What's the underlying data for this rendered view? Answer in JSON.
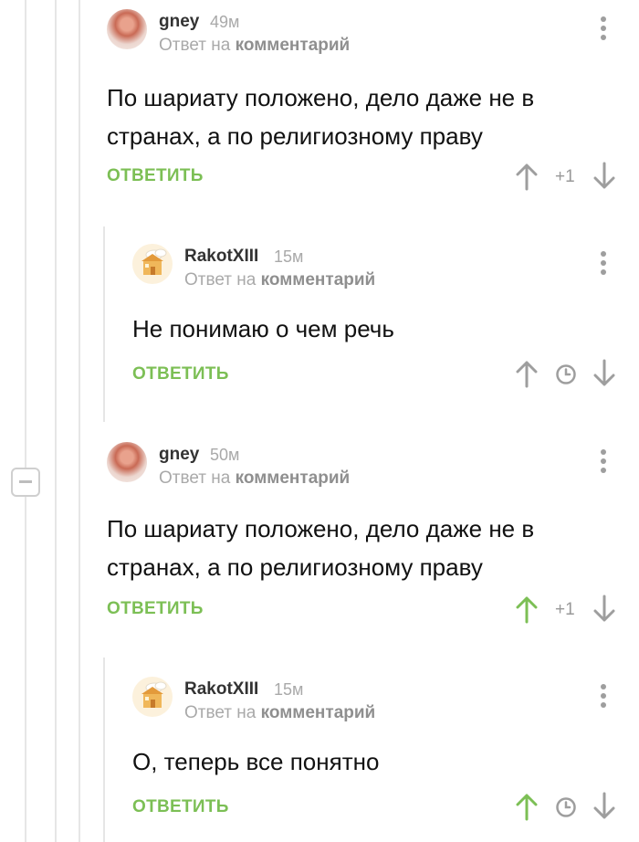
{
  "comments": [
    {
      "author": "gney",
      "time": "49м",
      "reply_prefix": "Ответ на",
      "reply_target": "комментарий",
      "text_lines": [
        "По шариату положено, дело даже не в",
        "странах, а по религиозному праву"
      ],
      "reply_label": "ОТВЕТИТЬ",
      "rating": "+1",
      "upvoted": false
    },
    {
      "author": "RakotXIII",
      "time": "15м",
      "reply_prefix": "Ответ на",
      "reply_target": "комментарий",
      "text_lines": [
        "Не понимаю о чем речь"
      ],
      "reply_label": "ОТВЕТИТЬ",
      "upvoted": false
    },
    {
      "author": "gney",
      "time": "50м",
      "reply_prefix": "Ответ на",
      "reply_target": "комментарий",
      "text_lines": [
        "По шариату положено, дело даже не в",
        "странах, а по религиозному праву"
      ],
      "reply_label": "ОТВЕТИТЬ",
      "rating": "+1",
      "upvoted": true
    },
    {
      "author": "RakotXIII",
      "time": "15м",
      "reply_prefix": "Ответ на",
      "reply_target": "комментарий",
      "text_lines": [
        "О, теперь все понятно"
      ],
      "reply_label": "ОТВЕТИТЬ",
      "upvoted": true
    }
  ],
  "colors": {
    "accent_green": "#7cbf55",
    "icon_gray": "#9e9e9e",
    "thread_line": "#e6e6e6"
  }
}
